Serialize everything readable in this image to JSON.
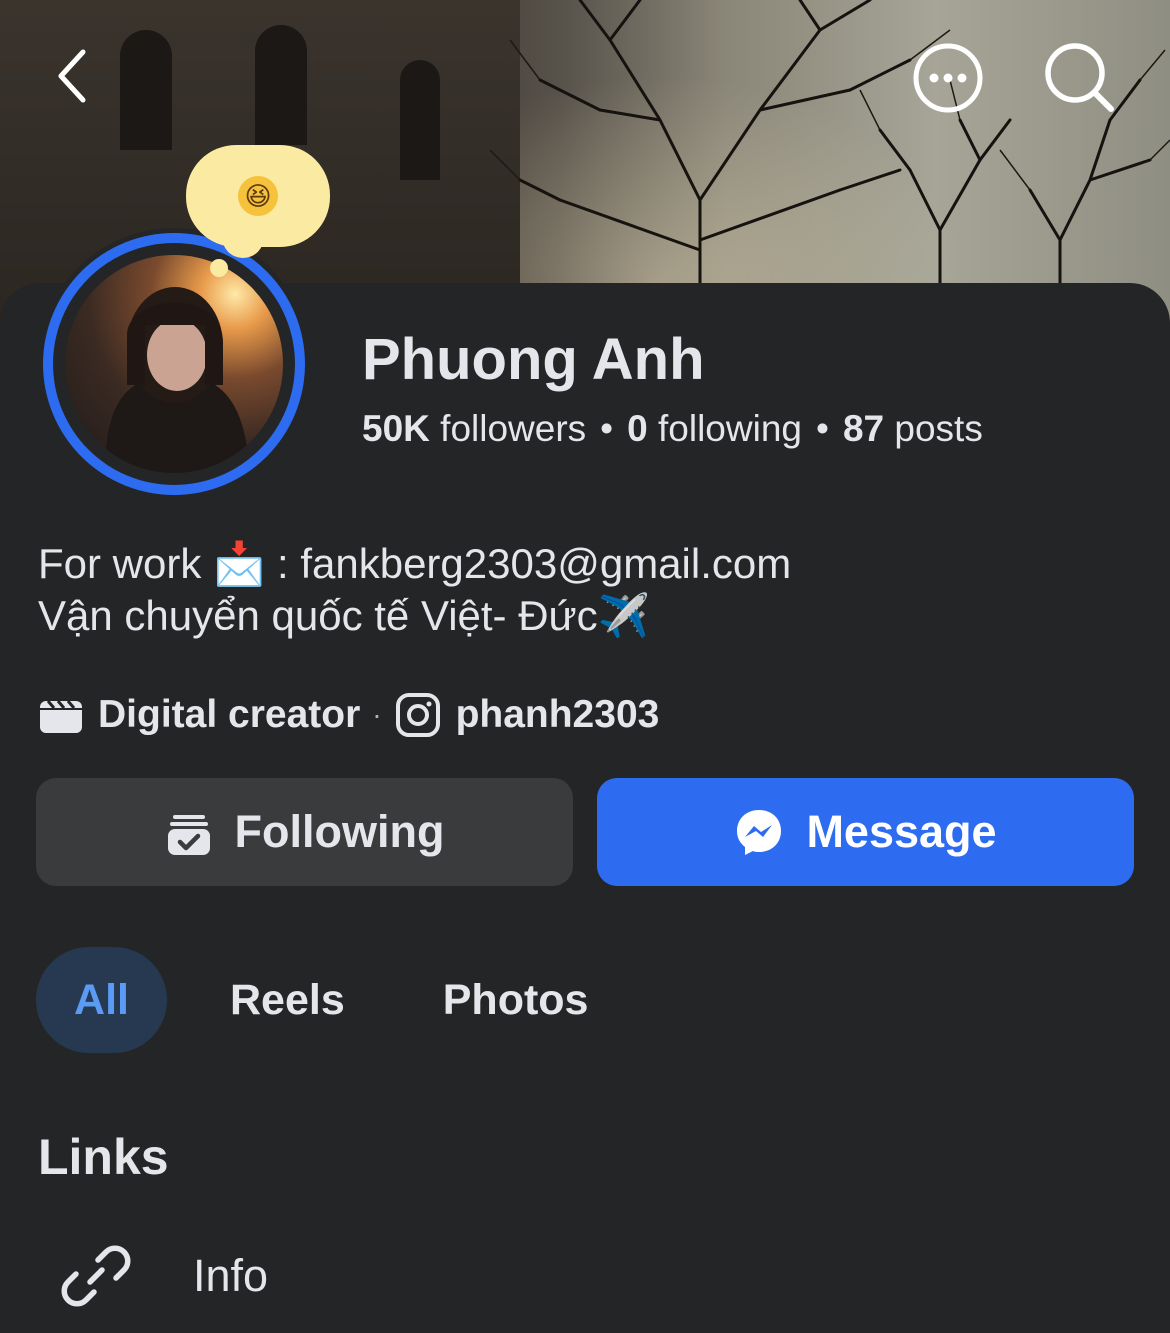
{
  "header": {
    "back_icon": "chevron-left-icon",
    "more_icon": "more-dots-icon",
    "search_icon": "search-icon"
  },
  "profile": {
    "status_emoji": "😆",
    "name": "Phuong Anh",
    "stats": {
      "followers_count": "50K",
      "followers_label": "followers",
      "following_count": "0",
      "following_label": "following",
      "posts_count": "87",
      "posts_label": "posts",
      "separator": "•"
    },
    "bio": {
      "line1_prefix": "For work ",
      "line1_emoji": "📩",
      "line1_suffix": " : fankberg2303@gmail.com",
      "line2": "Vận chuyển quốc tế Việt- Đức",
      "line2_emoji": "✈️"
    },
    "meta": {
      "category": "Digital creator",
      "separator": "·",
      "instagram_handle": "phanh2303"
    }
  },
  "actions": {
    "following_label": "Following",
    "message_label": "Message"
  },
  "tabs": [
    {
      "label": "All",
      "active": true
    },
    {
      "label": "Reels",
      "active": false
    },
    {
      "label": "Photos",
      "active": false
    }
  ],
  "links": {
    "title": "Links",
    "items": [
      {
        "label": "Info",
        "icon": "link-icon"
      }
    ]
  },
  "colors": {
    "background": "#242526",
    "accent": "#2d6cf0",
    "active_tab_bg": "#263951",
    "active_tab_text": "#5b9bf5",
    "button_secondary": "#3a3b3c",
    "status_bubble": "#fbeaa1"
  }
}
